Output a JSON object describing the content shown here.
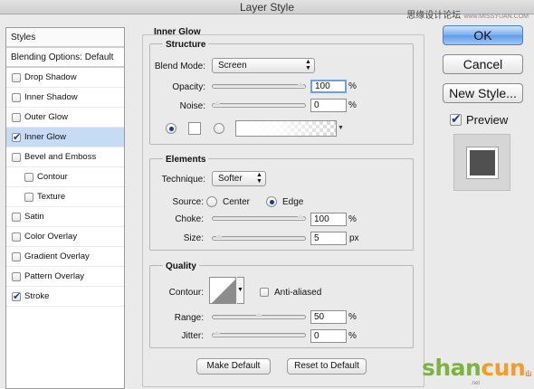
{
  "window": {
    "title": "Layer Style"
  },
  "watermark": {
    "top_cn": "思缘设计论坛",
    "top_url": "www.MISSYUAN.COM",
    "bottom_a": "shan",
    "bottom_b": "cun",
    "bottom_cn": "山村网",
    "bottom_url": ".net"
  },
  "styles_panel": {
    "header": "Styles",
    "blending_options": "Blending Options: Default",
    "items": [
      {
        "label": "Drop Shadow",
        "checked": false,
        "sub": false,
        "selected": false
      },
      {
        "label": "Inner Shadow",
        "checked": false,
        "sub": false,
        "selected": false
      },
      {
        "label": "Outer Glow",
        "checked": false,
        "sub": false,
        "selected": false
      },
      {
        "label": "Inner Glow",
        "checked": true,
        "sub": false,
        "selected": true
      },
      {
        "label": "Bevel and Emboss",
        "checked": false,
        "sub": false,
        "selected": false
      },
      {
        "label": "Contour",
        "checked": false,
        "sub": true,
        "selected": false
      },
      {
        "label": "Texture",
        "checked": false,
        "sub": true,
        "selected": false
      },
      {
        "label": "Satin",
        "checked": false,
        "sub": false,
        "selected": false
      },
      {
        "label": "Color Overlay",
        "checked": false,
        "sub": false,
        "selected": false
      },
      {
        "label": "Gradient Overlay",
        "checked": false,
        "sub": false,
        "selected": false
      },
      {
        "label": "Pattern Overlay",
        "checked": false,
        "sub": false,
        "selected": false
      },
      {
        "label": "Stroke",
        "checked": true,
        "sub": false,
        "selected": false
      }
    ]
  },
  "inner_glow": {
    "title": "Inner Glow",
    "structure": {
      "title": "Structure",
      "blend_mode_label": "Blend Mode:",
      "blend_mode_value": "Screen",
      "opacity_label": "Opacity:",
      "opacity_value": "100",
      "opacity_unit": "%",
      "opacity_level": 1.0,
      "noise_label": "Noise:",
      "noise_value": "0",
      "noise_unit": "%",
      "noise_level": 0.0,
      "color_selected": "solid",
      "color_swatch": "#ffffff"
    },
    "elements": {
      "title": "Elements",
      "technique_label": "Technique:",
      "technique_value": "Softer",
      "source_label": "Source:",
      "source_center": "Center",
      "source_edge": "Edge",
      "source_selected": "edge",
      "choke_label": "Choke:",
      "choke_value": "100",
      "choke_unit": "%",
      "choke_level": 1.0,
      "size_label": "Size:",
      "size_value": "5",
      "size_unit": "px",
      "size_level": 0.02
    },
    "quality": {
      "title": "Quality",
      "contour_label": "Contour:",
      "anti_aliased_label": "Anti-aliased",
      "anti_aliased_checked": false,
      "range_label": "Range:",
      "range_value": "50",
      "range_unit": "%",
      "range_level": 0.5,
      "jitter_label": "Jitter:",
      "jitter_value": "0",
      "jitter_unit": "%",
      "jitter_level": 0.0
    },
    "make_default": "Make Default",
    "reset_default": "Reset to Default"
  },
  "actions": {
    "ok": "OK",
    "cancel": "Cancel",
    "new_style": "New Style...",
    "preview_label": "Preview",
    "preview_checked": true
  }
}
